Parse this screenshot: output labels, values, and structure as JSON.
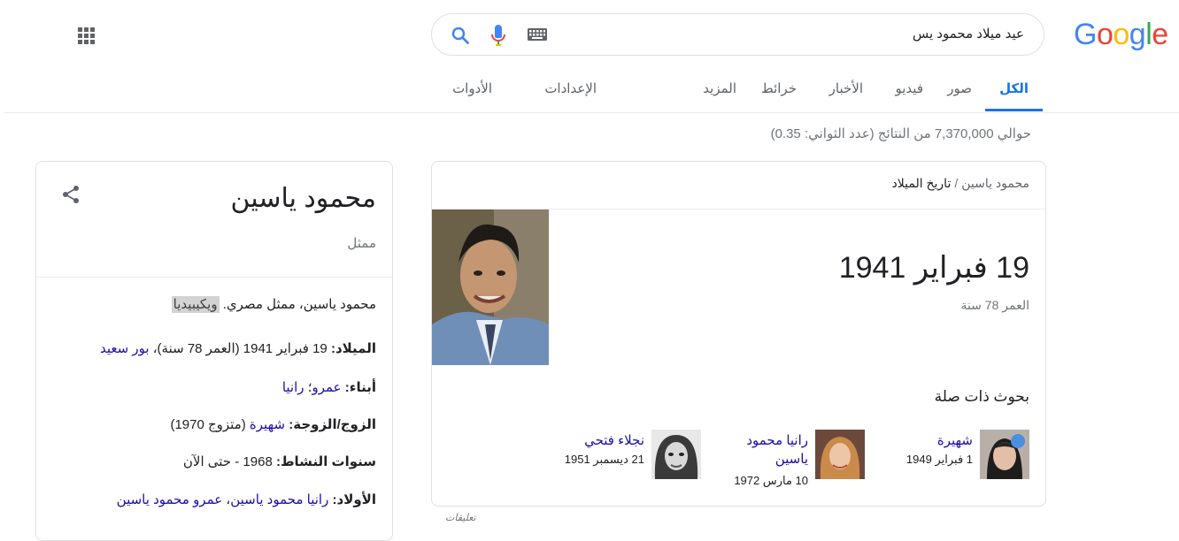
{
  "logo": {
    "letters": [
      "G",
      "o",
      "o",
      "g",
      "l",
      "e"
    ],
    "colors": [
      "#4285F4",
      "#EA4335",
      "#FBBC05",
      "#4285F4",
      "#34A853",
      "#EA4335"
    ]
  },
  "search": {
    "query": "عيد ميلاد محمود يس"
  },
  "icons": {
    "apps": "apps-grid-icon",
    "search": "search-icon",
    "mic": "mic-icon",
    "keyboard": "keyboard-icon",
    "share": "share-icon"
  },
  "tabs": {
    "all": "الكل",
    "images": "صور",
    "videos": "فيديو",
    "news": "الأخبار",
    "maps": "خرائط",
    "more": "المزيد",
    "settings": "الإعدادات",
    "tools": "الأدوات"
  },
  "result_stats": "حوالي 7,370,000 من النتائج (عدد الثواني: 0.35)",
  "answer_card": {
    "breadcrumb_parent": "محمود ياسين",
    "breadcrumb_sep": "/",
    "breadcrumb_current": "تاريخ الميلاد",
    "date": "19 فبراير 1941",
    "age": "العمر 78 سنة",
    "related_title": "بحوث ذات صلة",
    "related": [
      {
        "name": "شهيرة",
        "date": "1 فبراير 1949"
      },
      {
        "name_line1": "رانيا محمود",
        "name_line2": "ياسين",
        "date": "10 مارس 1972"
      },
      {
        "name": "نجلاء فتحي",
        "date": "21 ديسمبر 1951"
      }
    ],
    "feedback": "تعليقات"
  },
  "knowledge_panel": {
    "title": "محمود ياسين",
    "subtitle": "ممثل",
    "description": "محمود ياسين، ممثل مصري.",
    "source": "ويكيبيديا",
    "facts": {
      "born_label": "الميلاد:",
      "born_value": "19 فبراير 1941 (العمر 78 سنة)،",
      "born_place": "بور سعيد",
      "children_label": "أبناء:",
      "child1": "عمرو",
      "child_sep": "؛",
      "child2": "رانيا",
      "spouse_label": "الزوج/الزوجة:",
      "spouse_name": "شهيرة",
      "spouse_rest": "(متزوج 1970)",
      "active_label": "سنوات النشاط:",
      "active_value": "1968 - حتى الآن",
      "kids_label": "الأولاد:",
      "kid1": "رانيا محمود ياسين",
      "kid_sep": "،",
      "kid2": "عمرو محمود ياسين"
    }
  }
}
